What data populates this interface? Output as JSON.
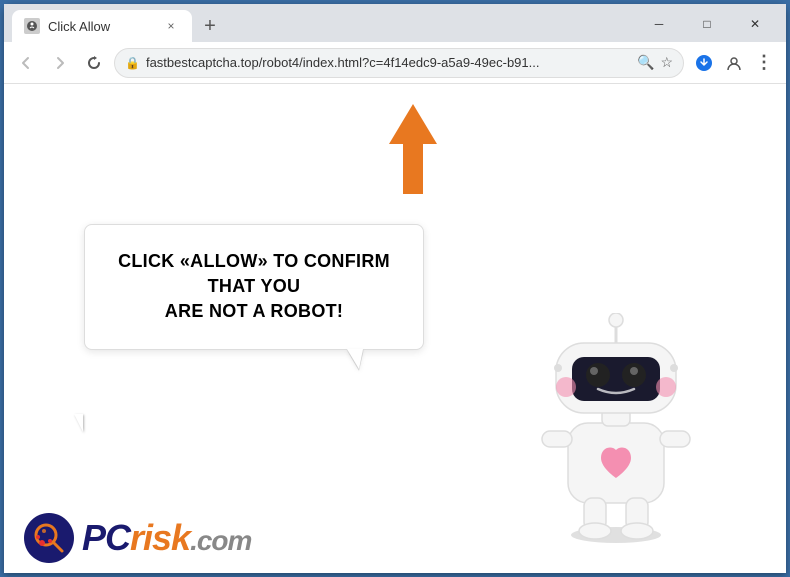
{
  "window": {
    "title": "Click Allow",
    "controls": {
      "minimize": "─",
      "maximize": "□",
      "close": "✕"
    }
  },
  "tab": {
    "favicon": "🔔",
    "label": "Click Allow",
    "close": "×"
  },
  "toolbar": {
    "back": "←",
    "forward": "→",
    "reload": "✕",
    "address": "fastbestcaptcha.top/robot4/index.html?c=4f14edc9-a5a9-49ec-b91...",
    "search_icon": "🔍",
    "bookmark_icon": "☆",
    "profile_icon": "👤",
    "menu_icon": "⋮",
    "download_icon": "⬇"
  },
  "page": {
    "bubble_text_line1": "CLICK «ALLOW» TO CONFIRM THAT YOU",
    "bubble_text_line2": "ARE NOT A ROBOT!",
    "pcrisk_label": "PC",
    "pcrisk_label2": "risk",
    "pcrisk_com": ".com"
  }
}
